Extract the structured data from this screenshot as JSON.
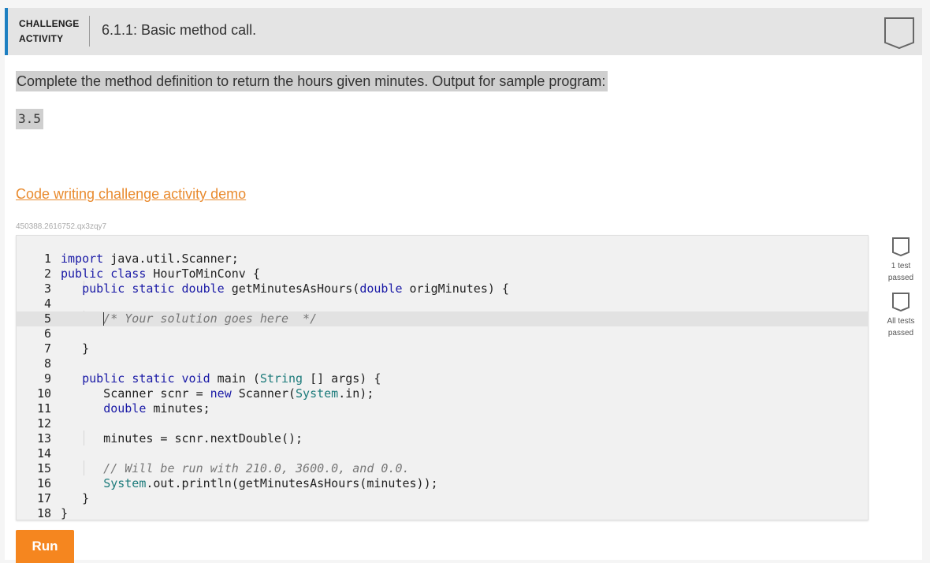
{
  "header": {
    "tag_line1": "CHALLENGE",
    "tag_line2": "ACTIVITY",
    "title": "6.1.1: Basic method call.",
    "badge_icon": "completion-badge-icon"
  },
  "prompt": "Complete the method definition to return the hours given minutes. Output for sample program:",
  "sample_output": "3.5",
  "demo_link": "Code writing challenge activity demo",
  "activity_id": "450388.2616752.qx3zqy7",
  "code_lines": [
    {
      "n": "1",
      "text": "import java.util.Scanner;"
    },
    {
      "n": "2",
      "text": "public class HourToMinConv {"
    },
    {
      "n": "3",
      "text": "   public static double getMinutesAsHours(double origMinutes) {"
    },
    {
      "n": "4",
      "text": ""
    },
    {
      "n": "5",
      "text": "      /* Your solution goes here  */"
    },
    {
      "n": "6",
      "text": ""
    },
    {
      "n": "7",
      "text": "   }"
    },
    {
      "n": "8",
      "text": ""
    },
    {
      "n": "9",
      "text": "   public static void main (String [] args) {"
    },
    {
      "n": "10",
      "text": "      Scanner scnr = new Scanner(System.in);"
    },
    {
      "n": "11",
      "text": "      double minutes;"
    },
    {
      "n": "12",
      "text": ""
    },
    {
      "n": "13",
      "text": "      minutes = scnr.nextDouble();"
    },
    {
      "n": "14",
      "text": ""
    },
    {
      "n": "15",
      "text": "      // Will be run with 210.0, 3600.0, and 0.0."
    },
    {
      "n": "16",
      "text": "      System.out.println(getMinutesAsHours(minutes));"
    },
    {
      "n": "17",
      "text": "   }"
    },
    {
      "n": "18",
      "text": "}"
    }
  ],
  "tests": [
    {
      "line1": "1 test",
      "line2": "passed",
      "icon": "test-status-icon"
    },
    {
      "line1": "All tests",
      "line2": "passed",
      "icon": "test-status-icon"
    }
  ],
  "run_label": "Run",
  "colors": {
    "accent": "#1d7fc1",
    "link": "#e98b2f",
    "run": "#f5861f"
  }
}
